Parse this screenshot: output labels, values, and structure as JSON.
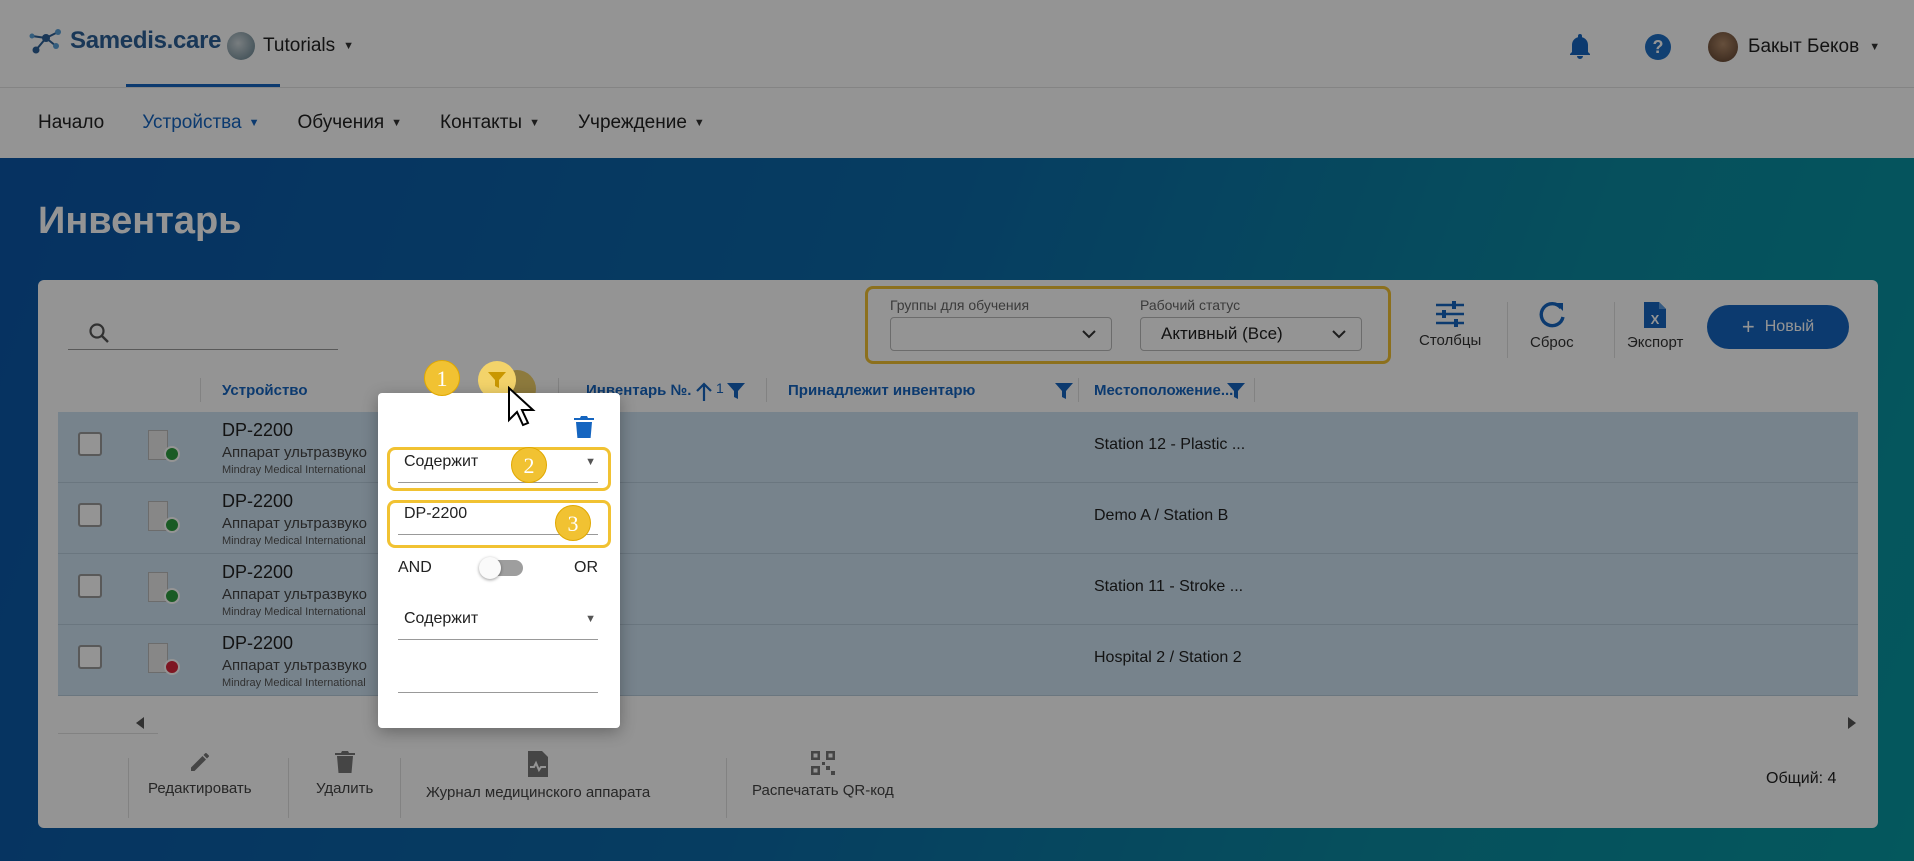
{
  "app": {
    "logo_text": "Samedis.care",
    "tenant": "Tutorials",
    "user": "Бакыт Беков"
  },
  "nav": {
    "items": [
      {
        "label": "Начало"
      },
      {
        "label": "Устройства"
      },
      {
        "label": "Обучения"
      },
      {
        "label": "Контакты"
      },
      {
        "label": "Учреждение"
      }
    ]
  },
  "page": {
    "title": "Инвентарь"
  },
  "filters": {
    "training_groups_label": "Группы для обучения",
    "training_groups_value": "",
    "work_status_label": "Рабочий статус",
    "work_status_value": "Активный (Все)"
  },
  "toolbar": {
    "columns_label": "Столбцы",
    "reset_label": "Сброс",
    "export_label": "Экспорт",
    "new_label": "Новый"
  },
  "table": {
    "headers": {
      "device": "Устройство",
      "inventory_no": "Инвентарь №.",
      "sort_index": "1",
      "owner": "Принадлежит инвентарю",
      "location": "Местоположение..."
    },
    "rows": [
      {
        "title": "DP-2200",
        "subtitle": "Аппарат ультразвуко",
        "manufacturer": "Mindray Medical International",
        "location": "Station 12 - Plastic ...",
        "status_color": "#2e9e3e"
      },
      {
        "title": "DP-2200",
        "subtitle": "Аппарат ультразвуко",
        "manufacturer": "Mindray Medical International",
        "location": "Demo A / Station B",
        "status_color": "#2e9e3e"
      },
      {
        "title": "DP-2200",
        "subtitle": "Аппарат ультразвуко",
        "manufacturer": "Mindray Medical International",
        "location": "Station 11 - Stroke ...",
        "status_color": "#2e9e3e"
      },
      {
        "title": "DP-2200",
        "subtitle": "Аппарат ультразвуко",
        "manufacturer": "Mindray Medical International",
        "location": "Hospital 2 / Station 2",
        "status_color": "#d9263b"
      }
    ]
  },
  "actions": {
    "edit": "Редактировать",
    "delete": "Удалить",
    "log": "Журнал медицинского аппарата",
    "qr": "Распечатать QR-код",
    "total": "Общий: 4"
  },
  "filter_popup": {
    "operator_1": "Содержит",
    "value_1": "DP-2200",
    "and_label": "AND",
    "or_label": "OR",
    "operator_2": "Содержит",
    "value_2": ""
  },
  "callouts": [
    "1",
    "2",
    "3"
  ],
  "colors": {
    "accent": "#1565c0",
    "highlight": "#f1c232"
  }
}
